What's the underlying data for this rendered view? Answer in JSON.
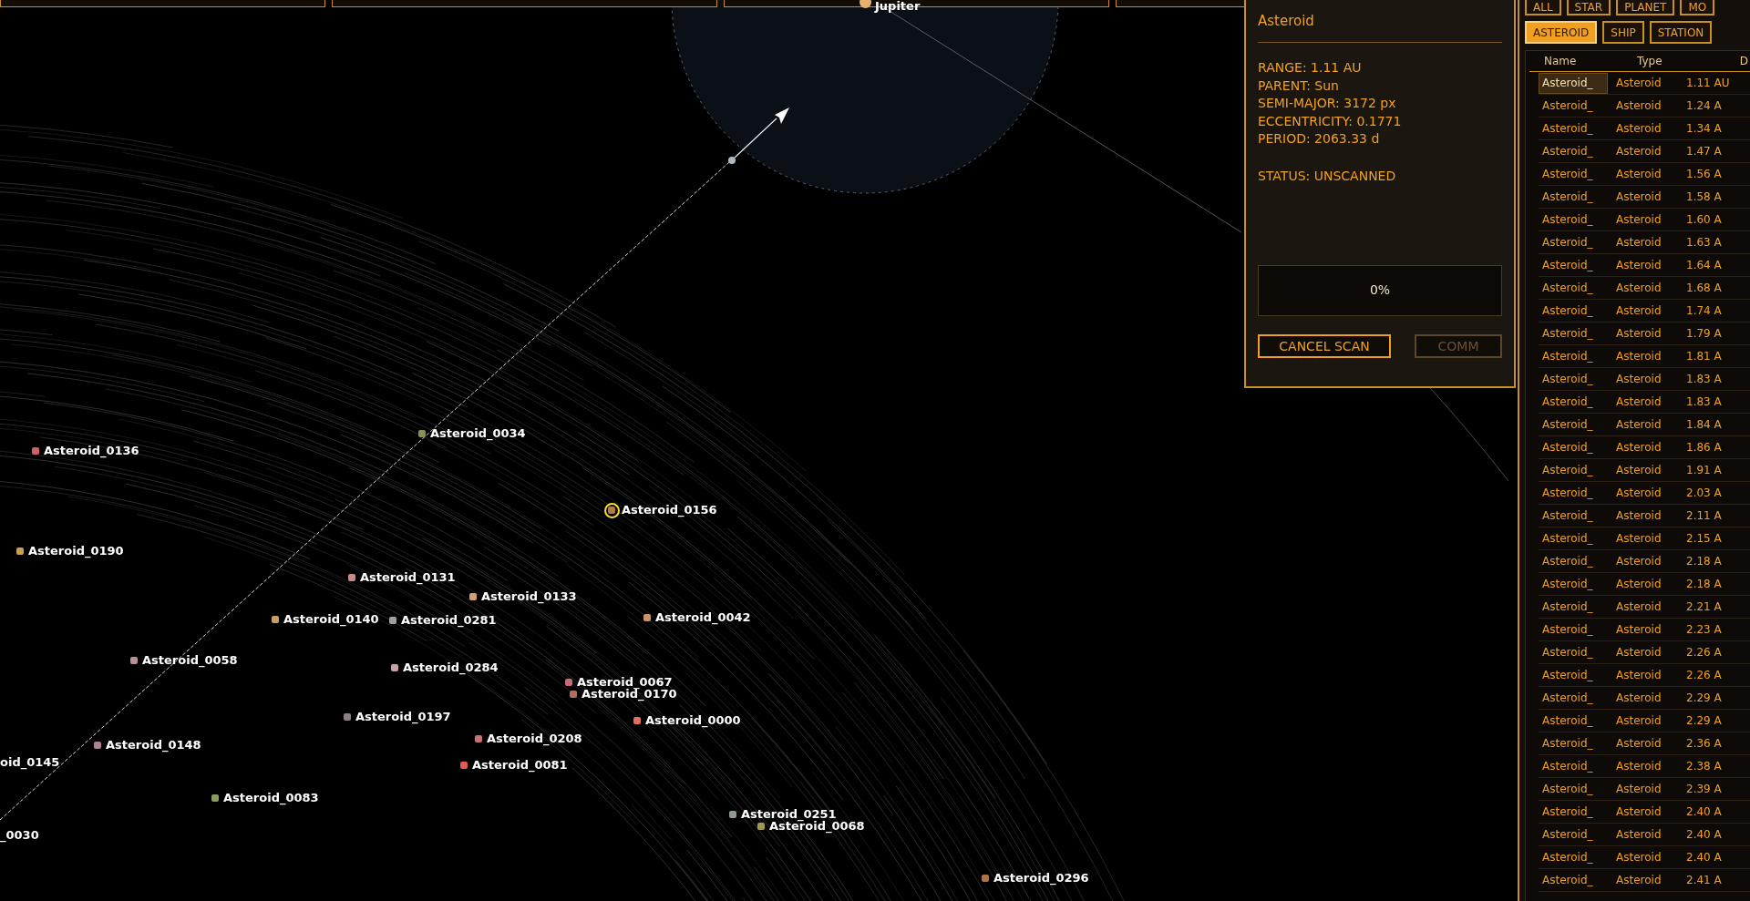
{
  "map": {
    "planet": {
      "label": "Jupiter"
    },
    "markers": [
      {
        "kind": "marker",
        "label": "Asteroid_0034",
        "color": "#8a8f5a",
        "selected": false
      },
      {
        "kind": "marker",
        "label": "Asteroid_0136",
        "color": "#d0606a",
        "selected": false
      },
      {
        "kind": "marker",
        "label": "Asteroid_0156",
        "color": "#b07a4a",
        "selected": true
      },
      {
        "kind": "marker",
        "label": "Asteroid_0190",
        "color": "#c9a050",
        "selected": false
      },
      {
        "kind": "marker",
        "label": "Asteroid_0131",
        "color": "#c88a8a",
        "selected": false
      },
      {
        "kind": "marker",
        "label": "Asteroid_0133",
        "color": "#d0a070",
        "selected": false
      },
      {
        "kind": "marker",
        "label": "Asteroid_0140",
        "color": "#c8a060",
        "selected": false
      },
      {
        "kind": "marker",
        "label": "Asteroid_0281",
        "color": "#a0a0a0",
        "selected": false
      },
      {
        "kind": "marker",
        "label": "Asteroid_0042",
        "color": "#d09060",
        "selected": false
      },
      {
        "kind": "marker",
        "label": "Asteroid_0058",
        "color": "#b89098",
        "selected": false
      },
      {
        "kind": "marker",
        "label": "Asteroid_0284",
        "color": "#c8a0a0",
        "selected": false
      },
      {
        "kind": "marker",
        "label": "Asteroid_0067",
        "color": "#c86a78",
        "selected": false
      },
      {
        "kind": "marker",
        "label": "Asteroid_0170",
        "color": "#b07060",
        "selected": false
      },
      {
        "kind": "marker",
        "label": "Asteroid_0197",
        "color": "#8a8088",
        "selected": false
      },
      {
        "kind": "marker",
        "label": "Asteroid_0000",
        "color": "#e07060",
        "selected": false
      },
      {
        "kind": "marker",
        "label": "Asteroid_0208",
        "color": "#c87070",
        "selected": false
      },
      {
        "kind": "marker",
        "label": "Asteroid_0148",
        "color": "#b08090",
        "selected": false
      },
      {
        "kind": "marker",
        "label": "Asteroid_0081",
        "color": "#e05a5a",
        "selected": false
      },
      {
        "kind": "marker",
        "label": "Asteroid_0083",
        "color": "#8a9a60",
        "selected": false
      },
      {
        "kind": "marker",
        "label": "Asteroid_0251",
        "color": "#909a90",
        "selected": false
      },
      {
        "kind": "marker",
        "label": "Asteroid_0068",
        "color": "#a09a50",
        "selected": false
      },
      {
        "kind": "marker",
        "label": "Asteroid_0296",
        "color": "#b07048",
        "selected": false
      },
      {
        "kind": "edge_label",
        "label": "oid_0145"
      },
      {
        "kind": "edge_label",
        "label": "_0030"
      }
    ]
  },
  "info_panel": {
    "title": "Asteroid",
    "stats": [
      "RANGE: 1.11 AU",
      "PARENT: Sun",
      "SEMI-MAJOR: 3172 px",
      "ECCENTRICITY: 0.1771",
      "PERIOD: 2063.33 d"
    ],
    "status": "STATUS: UNSCANNED",
    "scan": {
      "label": "0%",
      "level": 0
    },
    "buttons": [
      {
        "label": "CANCEL SCAN",
        "disabled": false
      },
      {
        "label": "COMM",
        "disabled": true
      }
    ]
  },
  "filter_rows": [
    [
      {
        "label": "ALL",
        "selected": false
      },
      {
        "label": "STAR",
        "selected": false
      },
      {
        "label": "PLANET",
        "selected": false
      },
      {
        "label": "MO",
        "selected": false
      }
    ],
    [
      {
        "label": "ASTEROID",
        "selected": true
      },
      {
        "label": "SHIP",
        "selected": false
      },
      {
        "label": "STATION",
        "selected": false
      }
    ]
  ],
  "table": {
    "columns": [
      "Name",
      "Type",
      "D"
    ],
    "rows": [
      {
        "name": "Asteroid_",
        "type": "Asteroid",
        "distance": "1.11 AU",
        "selected": true
      },
      {
        "name": "Asteroid_",
        "type": "Asteroid",
        "distance": "1.24 A",
        "selected": false
      },
      {
        "name": "Asteroid_",
        "type": "Asteroid",
        "distance": "1.34 A",
        "selected": false
      },
      {
        "name": "Asteroid_",
        "type": "Asteroid",
        "distance": "1.47 A",
        "selected": false
      },
      {
        "name": "Asteroid_",
        "type": "Asteroid",
        "distance": "1.56 A",
        "selected": false
      },
      {
        "name": "Asteroid_",
        "type": "Asteroid",
        "distance": "1.58 A",
        "selected": false
      },
      {
        "name": "Asteroid_",
        "type": "Asteroid",
        "distance": "1.60 A",
        "selected": false
      },
      {
        "name": "Asteroid_",
        "type": "Asteroid",
        "distance": "1.63 A",
        "selected": false
      },
      {
        "name": "Asteroid_",
        "type": "Asteroid",
        "distance": "1.64 A",
        "selected": false
      },
      {
        "name": "Asteroid_",
        "type": "Asteroid",
        "distance": "1.68 A",
        "selected": false
      },
      {
        "name": "Asteroid_",
        "type": "Asteroid",
        "distance": "1.74 A",
        "selected": false
      },
      {
        "name": "Asteroid_",
        "type": "Asteroid",
        "distance": "1.79 A",
        "selected": false
      },
      {
        "name": "Asteroid_",
        "type": "Asteroid",
        "distance": "1.81 A",
        "selected": false
      },
      {
        "name": "Asteroid_",
        "type": "Asteroid",
        "distance": "1.83 A",
        "selected": false
      },
      {
        "name": "Asteroid_",
        "type": "Asteroid",
        "distance": "1.83 A",
        "selected": false
      },
      {
        "name": "Asteroid_",
        "type": "Asteroid",
        "distance": "1.84 A",
        "selected": false
      },
      {
        "name": "Asteroid_",
        "type": "Asteroid",
        "distance": "1.86 A",
        "selected": false
      },
      {
        "name": "Asteroid_",
        "type": "Asteroid",
        "distance": "1.91 A",
        "selected": false
      },
      {
        "name": "Asteroid_",
        "type": "Asteroid",
        "distance": "2.03 A",
        "selected": false
      },
      {
        "name": "Asteroid_",
        "type": "Asteroid",
        "distance": "2.11 A",
        "selected": false
      },
      {
        "name": "Asteroid_",
        "type": "Asteroid",
        "distance": "2.15 A",
        "selected": false
      },
      {
        "name": "Asteroid_",
        "type": "Asteroid",
        "distance": "2.18 A",
        "selected": false
      },
      {
        "name": "Asteroid_",
        "type": "Asteroid",
        "distance": "2.18 A",
        "selected": false
      },
      {
        "name": "Asteroid_",
        "type": "Asteroid",
        "distance": "2.21 A",
        "selected": false
      },
      {
        "name": "Asteroid_",
        "type": "Asteroid",
        "distance": "2.23 A",
        "selected": false
      },
      {
        "name": "Asteroid_",
        "type": "Asteroid",
        "distance": "2.26 A",
        "selected": false
      },
      {
        "name": "Asteroid_",
        "type": "Asteroid",
        "distance": "2.26 A",
        "selected": false
      },
      {
        "name": "Asteroid_",
        "type": "Asteroid",
        "distance": "2.29 A",
        "selected": false
      },
      {
        "name": "Asteroid_",
        "type": "Asteroid",
        "distance": "2.29 A",
        "selected": false
      },
      {
        "name": "Asteroid_",
        "type": "Asteroid",
        "distance": "2.36 A",
        "selected": false
      },
      {
        "name": "Asteroid_",
        "type": "Asteroid",
        "distance": "2.38 A",
        "selected": false
      },
      {
        "name": "Asteroid_",
        "type": "Asteroid",
        "distance": "2.39 A",
        "selected": false
      },
      {
        "name": "Asteroid_",
        "type": "Asteroid",
        "distance": "2.40 A",
        "selected": false
      },
      {
        "name": "Asteroid_",
        "type": "Asteroid",
        "distance": "2.40 A",
        "selected": false
      },
      {
        "name": "Asteroid_",
        "type": "Asteroid",
        "distance": "2.40 A",
        "selected": false
      },
      {
        "name": "Asteroid_",
        "type": "Asteroid",
        "distance": "2.41 A",
        "selected": false
      }
    ]
  }
}
